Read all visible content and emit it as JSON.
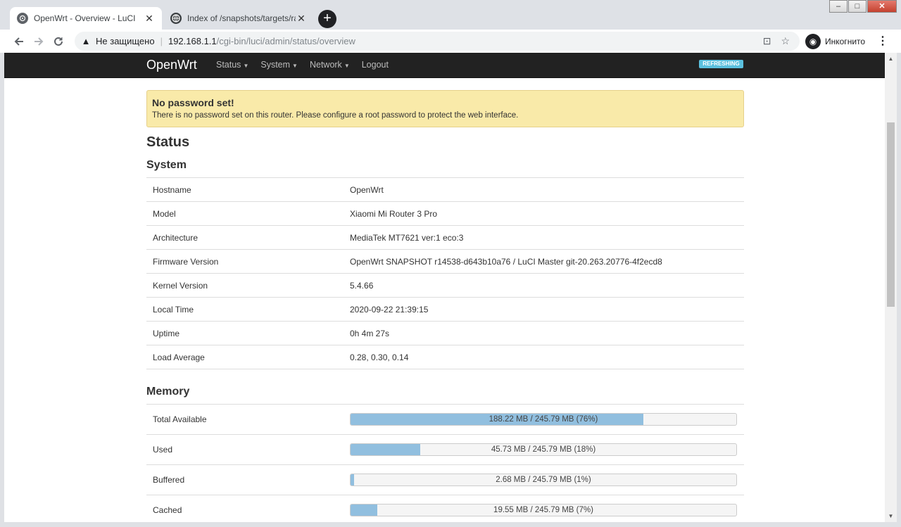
{
  "browser": {
    "tabs": [
      {
        "title": "OpenWrt - Overview - LuCI",
        "active": true
      },
      {
        "title": "Index of /snapshots/targets/ramips",
        "active": false
      }
    ],
    "new_tab_icon": "+",
    "security_label": "Не защищено",
    "url_host": "192.168.1.1",
    "url_path": "/cgi-bin/luci/admin/status/overview",
    "incognito_label": "Инкогнито"
  },
  "nav": {
    "brand": "OpenWrt",
    "menu": [
      {
        "label": "Status",
        "caret": true
      },
      {
        "label": "System",
        "caret": true
      },
      {
        "label": "Network",
        "caret": true
      },
      {
        "label": "Logout",
        "caret": false
      }
    ],
    "refreshing_badge": "REFRESHING"
  },
  "alert": {
    "title": "No password set!",
    "text": "There is no password set on this router. Please configure a root password to protect the web interface."
  },
  "page_title": "Status",
  "system": {
    "title": "System",
    "rows": [
      {
        "key": "Hostname",
        "value": "OpenWrt"
      },
      {
        "key": "Model",
        "value": "Xiaomi Mi Router 3 Pro"
      },
      {
        "key": "Architecture",
        "value": "MediaTek MT7621 ver:1 eco:3"
      },
      {
        "key": "Firmware Version",
        "value": "OpenWrt SNAPSHOT r14538-d643b10a76 / LuCI Master git-20.263.20776-4f2ecd8"
      },
      {
        "key": "Kernel Version",
        "value": "5.4.66"
      },
      {
        "key": "Local Time",
        "value": "2020-09-22 21:39:15"
      },
      {
        "key": "Uptime",
        "value": "0h 4m 27s"
      },
      {
        "key": "Load Average",
        "value": "0.28, 0.30, 0.14"
      }
    ]
  },
  "memory": {
    "title": "Memory",
    "rows": [
      {
        "key": "Total Available",
        "label": "188.22 MB / 245.79 MB (76%)",
        "fraction": 0.76
      },
      {
        "key": "Used",
        "label": "45.73 MB / 245.79 MB (18%)",
        "fraction": 0.18
      },
      {
        "key": "Buffered",
        "label": "2.68 MB / 245.79 MB (1%)",
        "fraction": 0.01
      },
      {
        "key": "Cached",
        "label": "19.55 MB / 245.79 MB (7%)",
        "fraction": 0.07
      }
    ]
  },
  "colors": {
    "navbar": "#222222",
    "alert_bg": "#f9eaa9",
    "progress_fill": "#91bfdf",
    "badge": "#5bc0de"
  }
}
